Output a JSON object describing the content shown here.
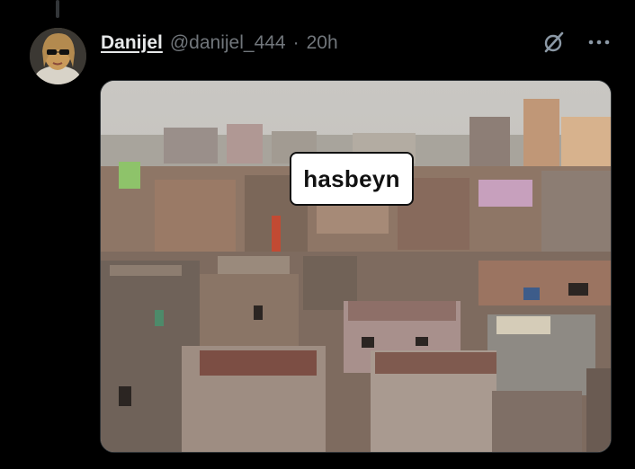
{
  "tweet": {
    "display_name": "Danijel",
    "handle": "@danijel_444",
    "separator": "·",
    "time": "20h"
  },
  "icons": {
    "grok": "grok-slash-icon",
    "more": "more-dots-icon"
  },
  "media": {
    "caption_bubble": "hasbeyn"
  },
  "colors": {
    "background": "#000000",
    "primary_text": "#e7e9ea",
    "secondary_text": "#71767b"
  }
}
